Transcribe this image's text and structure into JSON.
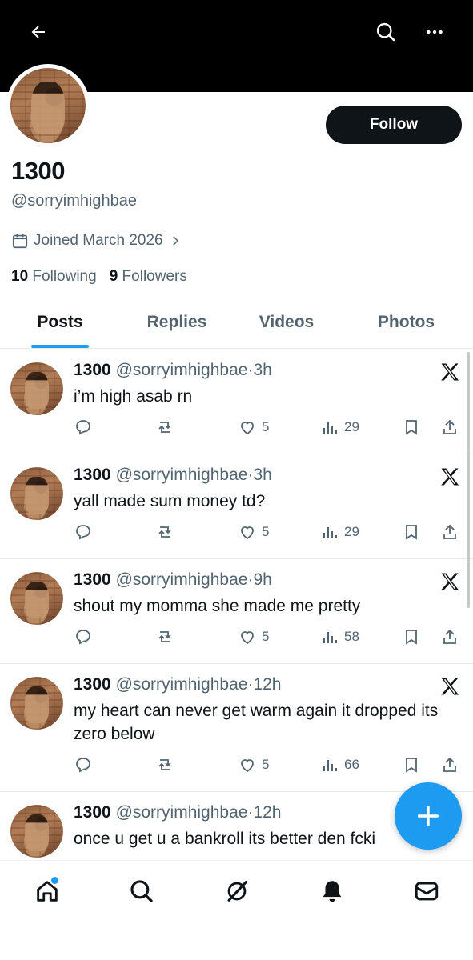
{
  "header": {
    "back": "back-arrow-icon",
    "search": "search-icon",
    "more": "more-icon"
  },
  "profile": {
    "follow_label": "Follow",
    "display_name": "1300",
    "handle": "@sorryimhighbae",
    "joined": "Joined March 2026",
    "following_count": "10",
    "following_label": "Following",
    "followers_count": "9",
    "followers_label": "Followers"
  },
  "tabs": [
    {
      "label": "Posts",
      "active": true
    },
    {
      "label": "Replies",
      "active": false
    },
    {
      "label": "Videos",
      "active": false
    },
    {
      "label": "Photos",
      "active": false
    }
  ],
  "posts": [
    {
      "name": "1300",
      "handle": "@sorryimhighbae",
      "time": "3h",
      "text": "i’m high asab rn",
      "likes": "5",
      "views": "29"
    },
    {
      "name": "1300",
      "handle": "@sorryimhighbae",
      "time": "3h",
      "text": "yall made sum money td?",
      "likes": "5",
      "views": "29"
    },
    {
      "name": "1300",
      "handle": "@sorryimhighbae",
      "time": "9h",
      "text": "shout my momma she made me pretty",
      "likes": "5",
      "views": "58"
    },
    {
      "name": "1300",
      "handle": "@sorryimhighbae",
      "time": "12h",
      "text": "my heart can never get warm again it dropped its zero below",
      "likes": "5",
      "views": "66"
    },
    {
      "name": "1300",
      "handle": "@sorryimhighbae",
      "time": "12h",
      "text": "once u get u a bankroll its better den fcki",
      "likes": "",
      "views": ""
    }
  ],
  "colors": {
    "accent": "#1d9bf0",
    "text": "#0f1419",
    "secondary": "#536471"
  }
}
